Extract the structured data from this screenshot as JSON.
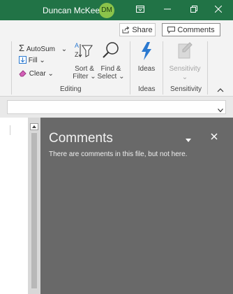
{
  "titlebar": {
    "user_name": "Duncan McKeen",
    "avatar_initials": "DM",
    "accent_color": "#217346"
  },
  "share_row": {
    "share_label": "Share",
    "comments_label": "Comments"
  },
  "ribbon": {
    "editing": {
      "autosum": "AutoSum",
      "fill": "Fill",
      "clear": "Clear",
      "sort_filter": [
        "Sort &",
        "Filter"
      ],
      "find_select": [
        "Find &",
        "Select"
      ],
      "group_label": "Editing"
    },
    "ideas": {
      "button_label": "Ideas",
      "group_label": "Ideas"
    },
    "sensitivity": {
      "button_label": "Sensitivity",
      "group_label": "Sensitivity"
    }
  },
  "comments_pane": {
    "title": "Comments",
    "message": "There are comments in this file, but not here."
  }
}
